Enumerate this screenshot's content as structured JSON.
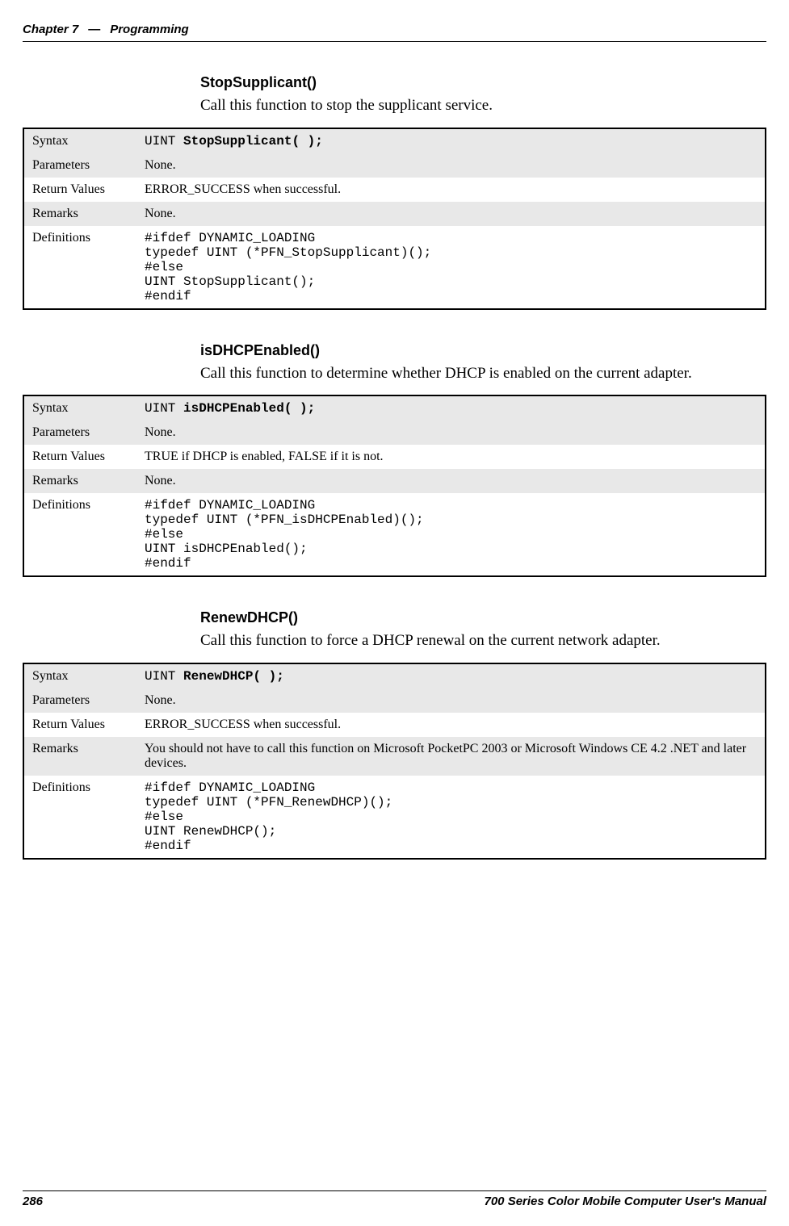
{
  "header": {
    "chapter": "Chapter 7",
    "dash": "—",
    "title": "Programming"
  },
  "sections": {
    "stop": {
      "heading": "StopSupplicant()",
      "text": "Call this function to stop the supplicant service.",
      "rows": {
        "syntax_label": "Syntax",
        "syntax_prefix": "UINT ",
        "syntax_bold": "StopSupplicant( );",
        "params_label": "Parameters",
        "params_value": "None.",
        "return_label": "Return Values",
        "return_value": "ERROR_SUCCESS when successful.",
        "remarks_label": "Remarks",
        "remarks_value": "None.",
        "defs_label": "Definitions",
        "defs_value": "#ifdef DYNAMIC_LOADING\ntypedef UINT (*PFN_StopSupplicant)();\n#else\nUINT StopSupplicant();\n#endif"
      }
    },
    "dhcp": {
      "heading": "isDHCPEnabled()",
      "text": "Call this function to determine whether DHCP is enabled on the current adapter.",
      "rows": {
        "syntax_label": "Syntax",
        "syntax_prefix": "UINT ",
        "syntax_bold": "isDHCPEnabled( );",
        "params_label": "Parameters",
        "params_value": "None.",
        "return_label": "Return Values",
        "return_value": "TRUE if DHCP is enabled, FALSE if it is not.",
        "remarks_label": "Remarks",
        "remarks_value": "None.",
        "defs_label": "Definitions",
        "defs_value": "#ifdef DYNAMIC_LOADING\ntypedef UINT (*PFN_isDHCPEnabled)();\n#else\nUINT isDHCPEnabled();\n#endif"
      }
    },
    "renew": {
      "heading": "RenewDHCP()",
      "text": "Call this function to force a DHCP renewal on the current network adapter.",
      "rows": {
        "syntax_label": "Syntax",
        "syntax_prefix": "UINT ",
        "syntax_bold": "RenewDHCP( );",
        "params_label": "Parameters",
        "params_value": "None.",
        "return_label": "Return Values",
        "return_value": "ERROR_SUCCESS when successful.",
        "remarks_label": "Remarks",
        "remarks_value": "You should not have to call this function on Microsoft PocketPC 2003 or Microsoft Windows CE 4.2 .NET and later devices.",
        "defs_label": "Definitions",
        "defs_value": "#ifdef DYNAMIC_LOADING\ntypedef UINT (*PFN_RenewDHCP)();\n#else\nUINT RenewDHCP();\n#endif"
      }
    }
  },
  "footer": {
    "page": "286",
    "title": "700 Series Color Mobile Computer User's Manual"
  }
}
